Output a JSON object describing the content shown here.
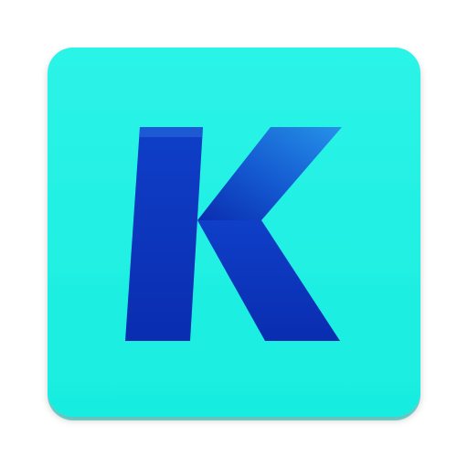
{
  "icon": {
    "logo_letter": "K",
    "colors": {
      "tile": "#18EDE0",
      "tile_top": "#2CF3E7",
      "tile_shadow": "#0FC7BC",
      "letter_light": "#1F86E0",
      "letter_dark": "#0A2FB8"
    }
  }
}
